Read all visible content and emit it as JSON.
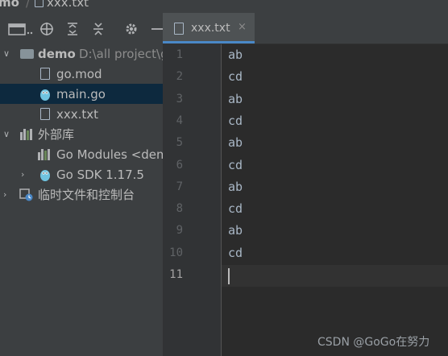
{
  "breadcrumb": {
    "project": "mo",
    "file": "xxx.txt"
  },
  "toolbar": {
    "buttons": [
      "project-view-dropdown",
      "locate-icon",
      "expand-all-icon",
      "collapse-all-icon",
      "gear-icon",
      "minimize-icon"
    ]
  },
  "tree": {
    "root_name": "demo",
    "root_path": "D:\\all project\\g",
    "files": [
      "go.mod",
      "main.go",
      "xxx.txt"
    ],
    "external_libraries": "外部库",
    "go_modules": "Go Modules <dem",
    "go_sdk": "Go SDK 1.17.5",
    "scratches": "临时文件和控制台"
  },
  "editor": {
    "tab_label": "xxx.txt",
    "tab_close": "×",
    "line_numbers": [
      "1",
      "2",
      "3",
      "4",
      "5",
      "6",
      "7",
      "8",
      "9",
      "10",
      "11"
    ],
    "lines": [
      "ab",
      "cd",
      "ab",
      "cd",
      "ab",
      "cd",
      "ab",
      "cd",
      "ab",
      "cd",
      ""
    ]
  },
  "watermark": "CSDN @GoGo在努力",
  "colors": {
    "selection": "#0d293e",
    "tab_accent": "#4a88c7",
    "background": "#2b2b2b",
    "panel": "#3c3f41"
  }
}
